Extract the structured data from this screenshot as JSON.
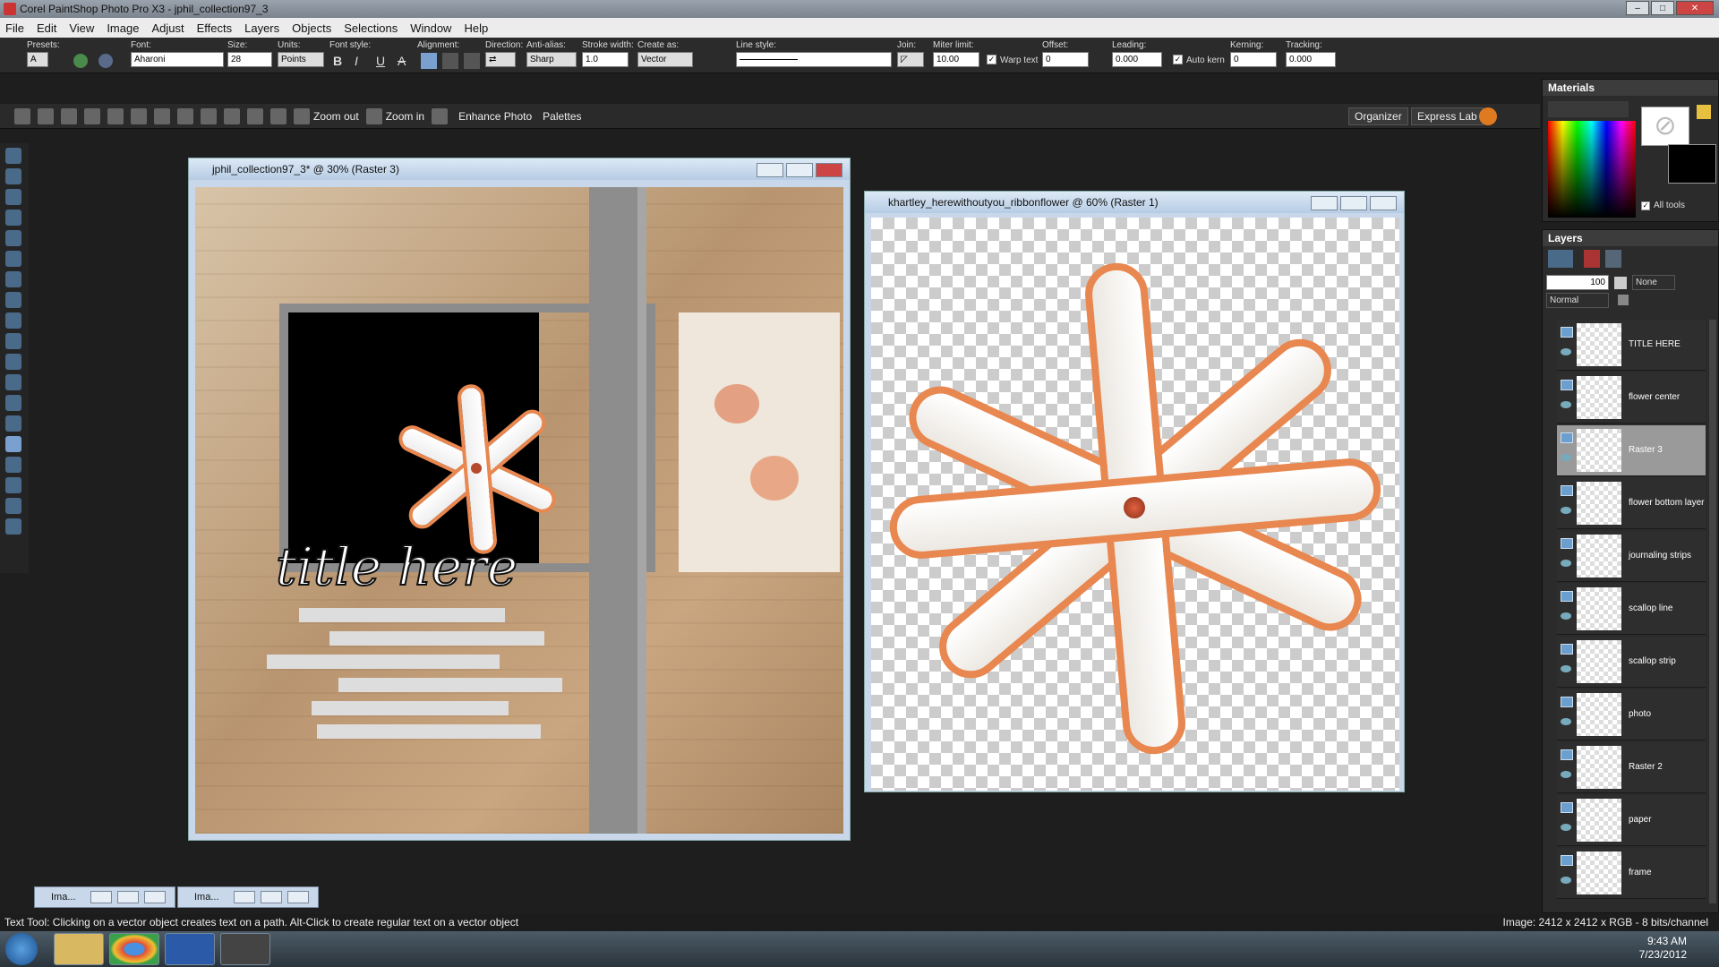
{
  "window": {
    "title": "Corel PaintShop Photo Pro X3 - jphil_collection97_3"
  },
  "menu": [
    "File",
    "Edit",
    "View",
    "Image",
    "Adjust",
    "Effects",
    "Layers",
    "Objects",
    "Selections",
    "Window",
    "Help"
  ],
  "tool_options": {
    "presets_label": "Presets:",
    "font_label": "Font:",
    "font_value": "Aharoni",
    "size_label": "Size:",
    "size_value": "28",
    "units_label": "Units:",
    "units_value": "Points",
    "font_style_label": "Font style:",
    "alignment_label": "Alignment:",
    "direction_label": "Direction:",
    "antialias_label": "Anti-alias:",
    "antialias_value": "Sharp",
    "stroke_label": "Stroke width:",
    "stroke_value": "1.0",
    "create_as_label": "Create as:",
    "create_as_value": "Vector",
    "line_style_label": "Line style:",
    "join_label": "Join:",
    "miter_label": "Miter limit:",
    "miter_value": "10.00",
    "warp_text": "Warp text",
    "offset_label": "Offset:",
    "offset_value": "0",
    "leading_label": "Leading:",
    "leading_value": "0.000",
    "auto_kern": "Auto kern",
    "kerning_label": "Kerning:",
    "kerning_value": "0",
    "tracking_label": "Tracking:",
    "tracking_value": "0.000"
  },
  "standard_toolbar": {
    "zoom_out": "Zoom out",
    "zoom_in": "Zoom in",
    "enhance_photo": "Enhance Photo",
    "palettes": "Palettes",
    "organizer": "Organizer",
    "express_lab": "Express Lab"
  },
  "doc1": {
    "title": "jphil_collection97_3* @  30% (Raster 3)",
    "title_art": "title here"
  },
  "doc2": {
    "title": "khartley_herewithoutyou_ribbonflower @  60% (Raster 1)"
  },
  "materials": {
    "title": "Materials",
    "all_tools": "All tools"
  },
  "layers_panel": {
    "title": "Layers",
    "opacity": "100",
    "blend": "Normal",
    "mask": "None",
    "items": [
      {
        "name": "TITLE HERE"
      },
      {
        "name": "flower center"
      },
      {
        "name": "Raster 3"
      },
      {
        "name": "flower bottom layer"
      },
      {
        "name": "journaling strips"
      },
      {
        "name": "scallop line"
      },
      {
        "name": "scallop strip"
      },
      {
        "name": "photo"
      },
      {
        "name": "Raster 2"
      },
      {
        "name": "paper"
      },
      {
        "name": "frame"
      }
    ]
  },
  "minimized": [
    "Ima...",
    "Ima..."
  ],
  "status": {
    "left": "Text Tool: Clicking on a vector object creates text on a path. Alt-Click to create regular text on a vector object",
    "right": "Image:  2412 x 2412 x RGB - 8 bits/channel"
  },
  "clock": {
    "time": "9:43 AM",
    "date": "7/23/2012"
  }
}
